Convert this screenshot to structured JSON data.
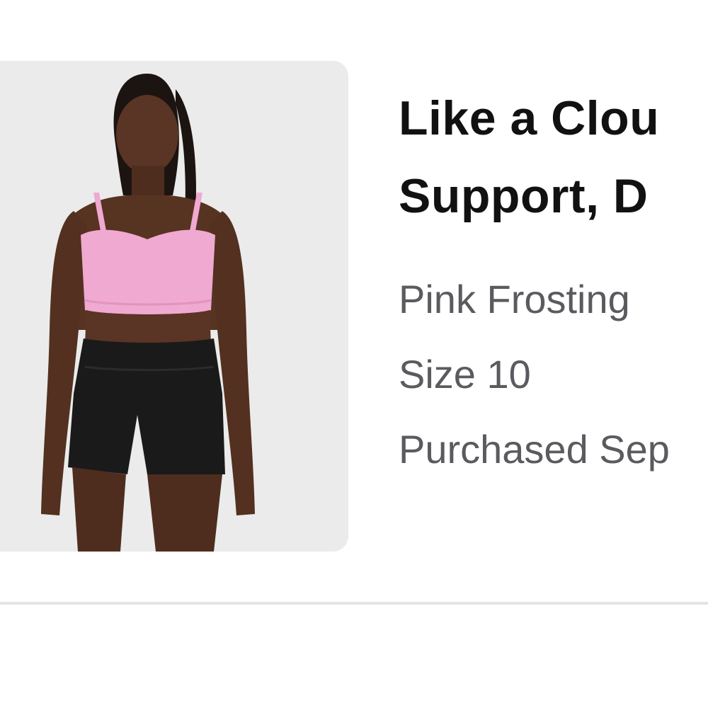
{
  "product": {
    "title_line1": "Like a Clou",
    "title_line2": "Support, D",
    "color": "Pink Frosting",
    "size": "Size 10",
    "purchased": "Purchased Sep",
    "image": {
      "subject": "model-photo",
      "top_color": "#f0a9d0",
      "bottom_color": "#1a1a1a",
      "background": "#ebebeb"
    }
  }
}
